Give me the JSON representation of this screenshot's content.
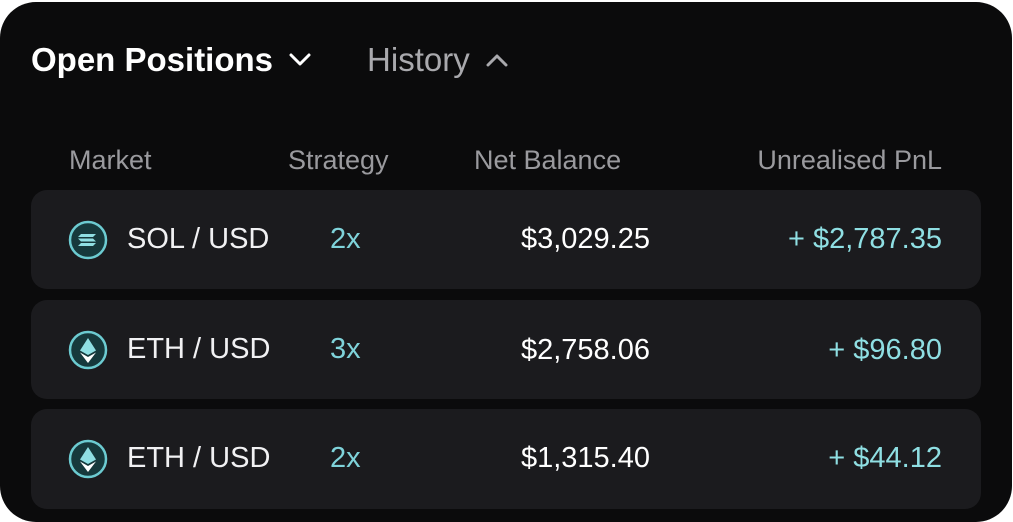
{
  "tabs": {
    "open_label": "Open Positions",
    "history_label": "History"
  },
  "table": {
    "headers": {
      "market": "Market",
      "strategy": "Strategy",
      "net_balance": "Net Balance",
      "pnl": "Unrealised PnL"
    },
    "rows": [
      {
        "icon": "solana-icon",
        "market": "SOL / USD",
        "strategy": "2x",
        "net_balance": "$3,029.25",
        "pnl": "+ $2,787.35"
      },
      {
        "icon": "ethereum-icon",
        "market": "ETH / USD",
        "strategy": "3x",
        "net_balance": "$2,758.06",
        "pnl": "+ $96.80"
      },
      {
        "icon": "ethereum-icon",
        "market": "ETH / USD",
        "strategy": "2x",
        "net_balance": "$1,315.40",
        "pnl": "+ $44.12"
      }
    ]
  },
  "colors": {
    "background": "#0b0b0c",
    "row": "#1b1b1e",
    "accent": "#8fdfe3",
    "muted": "#9a9a9e"
  }
}
